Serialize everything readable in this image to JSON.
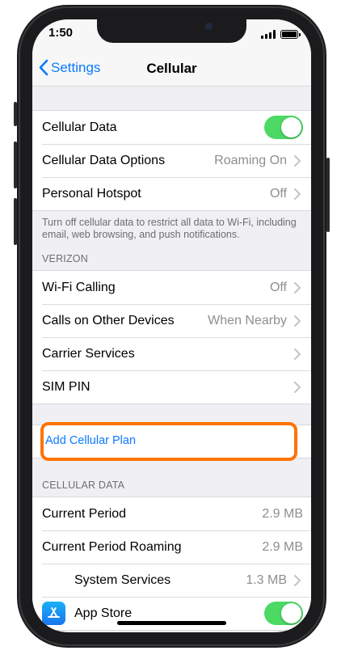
{
  "status_bar": {
    "time": "1:50"
  },
  "nav": {
    "back_label": "Settings",
    "title": "Cellular"
  },
  "group1": [
    {
      "label": "Cellular Data",
      "toggle": true
    },
    {
      "label": "Cellular Data Options",
      "value": "Roaming On"
    },
    {
      "label": "Personal Hotspot",
      "value": "Off"
    }
  ],
  "group1_note": "Turn off cellular data to restrict all data to Wi-Fi, including email, web browsing, and push notifications.",
  "verizon_header": "VERIZON",
  "group2": [
    {
      "label": "Wi-Fi Calling",
      "value": "Off"
    },
    {
      "label": "Calls on Other Devices",
      "value": "When Nearby"
    },
    {
      "label": "Carrier Services",
      "value": ""
    },
    {
      "label": "SIM PIN",
      "value": ""
    }
  ],
  "add_plan_label": "Add Cellular Plan",
  "cellular_data_header": "CELLULAR DATA",
  "group3": [
    {
      "label": "Current Period",
      "value": "2.9 MB"
    },
    {
      "label": "Current Period Roaming",
      "value": "2.9 MB"
    },
    {
      "label": "System Services",
      "value": "1.3 MB"
    },
    {
      "label": "App Store",
      "toggle": true
    }
  ],
  "colors": {
    "accent": "#0a7aff",
    "toggle_on": "#4cd964",
    "highlight": "#ff7300"
  },
  "icons": [
    "chevron-left-icon",
    "chevron-right-icon",
    "signal-icon",
    "battery-icon",
    "app-store-icon"
  ]
}
